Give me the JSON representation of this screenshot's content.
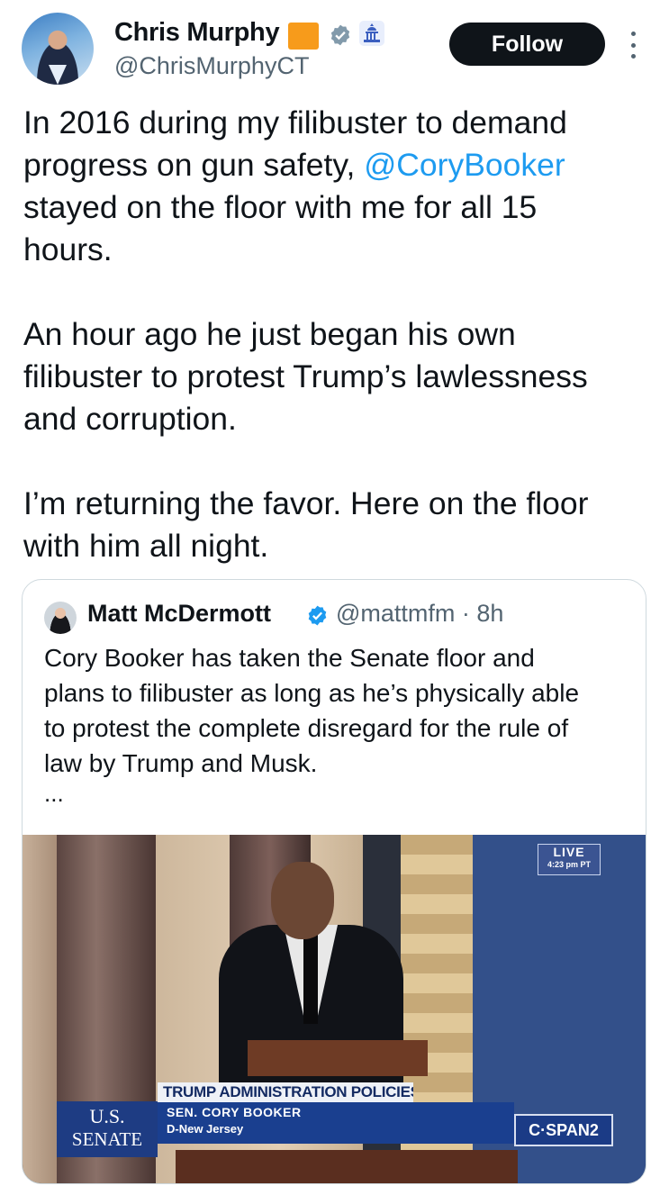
{
  "author": {
    "name": "Chris Murphy",
    "handle": "@ChrisMurphyCT",
    "badges": [
      "orange-square-emoji",
      "verified-government-icon",
      "capitol-building-icon"
    ],
    "follow_label": "Follow"
  },
  "tweet": {
    "para1_line1": "In 2016 during my filibuster to demand",
    "para1_line2_prefix": "progress on gun safety, ",
    "para1_mention": "@CoryBooker",
    "para1_line3": "stayed on the floor with me for all 15",
    "para1_line4": "hours.",
    "para2_line1": "An hour ago he just began his own",
    "para2_line2": "filibuster to protest Trump’s lawlessness",
    "para2_line3": "and corruption.",
    "para3_line1": "I’m returning the favor. Here on the floor",
    "para3_line2": "with him all night."
  },
  "quote": {
    "name": "Matt McDermott",
    "handle_time": "@mattmfm · 8h",
    "line1": "Cory Booker has taken the Senate floor and",
    "line2": "plans to filibuster as long as he’s physically able",
    "line3": "to protest the complete disregard for the rule of",
    "line4": "law by Trump and Musk.",
    "ellipsis": "...",
    "video": {
      "live_label": "LIVE",
      "live_time": "4:23 pm PT",
      "senate_line1": "U.S.",
      "senate_line2": "SENATE",
      "topic": "TRUMP ADMINISTRATION POLICIES",
      "speaker_name": "SEN. CORY BOOKER",
      "speaker_party": "D-New Jersey",
      "network": "C·SPAN2"
    }
  },
  "colors": {
    "link": "#1d9bf0",
    "text": "#0f1419",
    "secondary": "#536471"
  }
}
